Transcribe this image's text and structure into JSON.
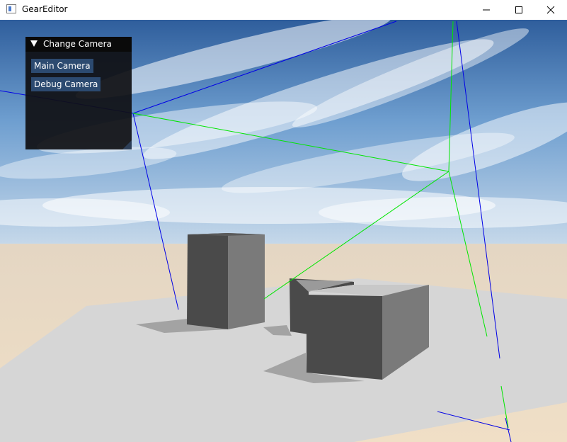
{
  "window": {
    "title": "GearEditor",
    "controls": {
      "minimize_icon": "minimize-icon",
      "maximize_icon": "maximize-icon",
      "close_icon": "close-icon"
    }
  },
  "panel": {
    "header": "Change Camera",
    "collapse_icon": "triangle-down-icon",
    "buttons": [
      {
        "label": "Main Camera"
      },
      {
        "label": "Debug Camera"
      }
    ]
  },
  "colors": {
    "frustum_blue": "#0000e6",
    "frustum_green": "#00e600",
    "imgui_button": "#2c4a70",
    "imgui_title": "#0a0a0a"
  }
}
